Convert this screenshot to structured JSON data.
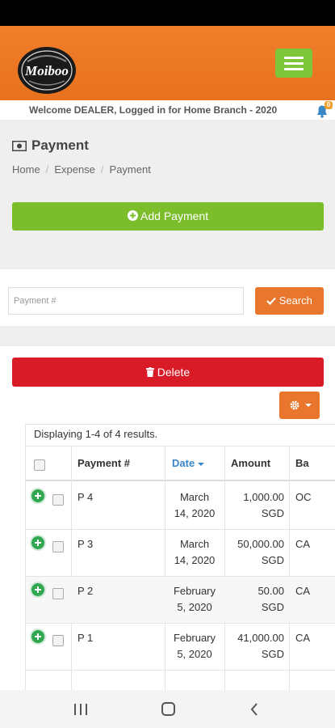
{
  "header": {
    "logo_text": "Moiboo",
    "welcome": "Welcome DEALER, Logged in for Home Branch - 2020",
    "notification_count": "0"
  },
  "page": {
    "title": "Payment",
    "icon": "money-icon",
    "breadcrumb": [
      "Home",
      "Expense",
      "Payment"
    ]
  },
  "actions": {
    "add_label": "Add Payment",
    "search_placeholder": "Payment #",
    "search_label": "Search",
    "delete_label": "Delete"
  },
  "grid": {
    "summary": "Displaying 1-4 of 4 results.",
    "columns": [
      "Payment #",
      "Date",
      "Amount",
      "Ba"
    ],
    "sorted_column": "Date",
    "rows": [
      {
        "payment": "P 4",
        "date_line1": "March",
        "date_line2": "14, 2020",
        "amount_line1": "1,000.00",
        "amount_line2": "SGD",
        "bank": "OC"
      },
      {
        "payment": "P 3",
        "date_line1": "March",
        "date_line2": "14, 2020",
        "amount_line1": "50,000.00",
        "amount_line2": "SGD",
        "bank": "CA"
      },
      {
        "payment": "P 2",
        "date_line1": "February",
        "date_line2": "5, 2020",
        "amount_line1": "50.00",
        "amount_line2": "SGD",
        "bank": "CA"
      },
      {
        "payment": "P 1",
        "date_line1": "February",
        "date_line2": "5, 2020",
        "amount_line1": "41,000.00",
        "amount_line2": "SGD",
        "bank": "CA"
      }
    ]
  },
  "colors": {
    "header": "#e8721e",
    "menu_button": "#7dc63a",
    "add_button": "#7bbd2b",
    "search_button": "#e8762c",
    "delete_button": "#d81b27",
    "sort_link": "#3a87c8"
  }
}
